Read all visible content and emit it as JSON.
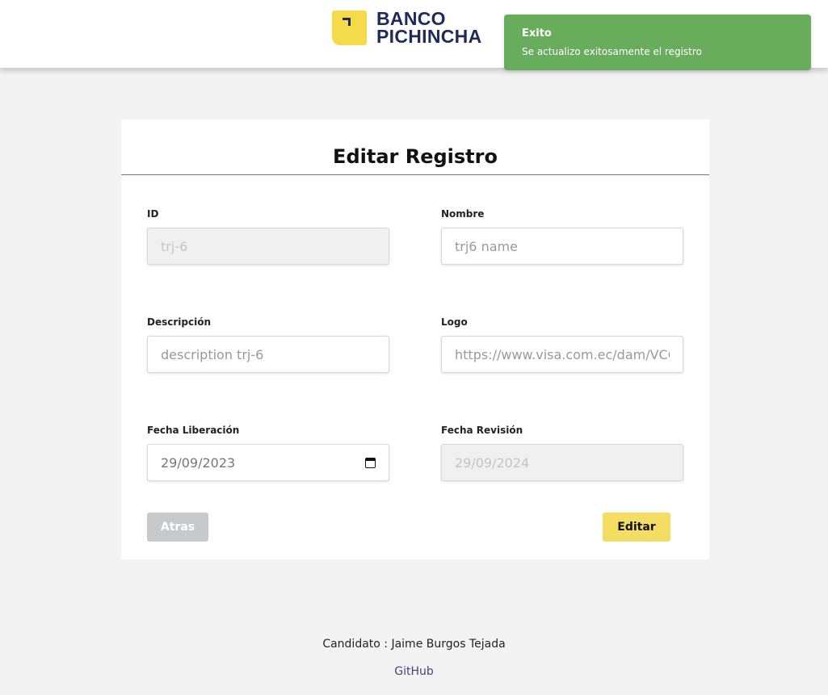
{
  "header": {
    "brand_line1": "BANCO",
    "brand_line2": "PICHINCHA"
  },
  "toast": {
    "title": "Exito",
    "message": "Se actualizo exitosamente el registro",
    "color": "#67ad5b"
  },
  "form": {
    "title": "Editar Registro",
    "fields": {
      "id": {
        "label": "ID",
        "value": "trj-6",
        "disabled": true
      },
      "nombre": {
        "label": "Nombre",
        "value": "trj6 name"
      },
      "descripcion": {
        "label": "Descripción",
        "value": "description trj-6"
      },
      "logo": {
        "label": "Logo",
        "value": "https://www.visa.com.ec/dam/VCOI"
      },
      "fecha_liberacion": {
        "label": "Fecha Liberación",
        "value": "29/09/2023"
      },
      "fecha_revision": {
        "label": "Fecha Revisión",
        "value": "29/09/2024",
        "disabled": true
      }
    },
    "buttons": {
      "back": "Atras",
      "edit": "Editar"
    }
  },
  "footer": {
    "candidate": "Candidato : Jaime Burgos Tejada",
    "link": "GitHub"
  },
  "colors": {
    "brand_yellow": "#f5da4a",
    "brand_navy": "#1f2a5a",
    "edit_button": "#f4dd63"
  }
}
